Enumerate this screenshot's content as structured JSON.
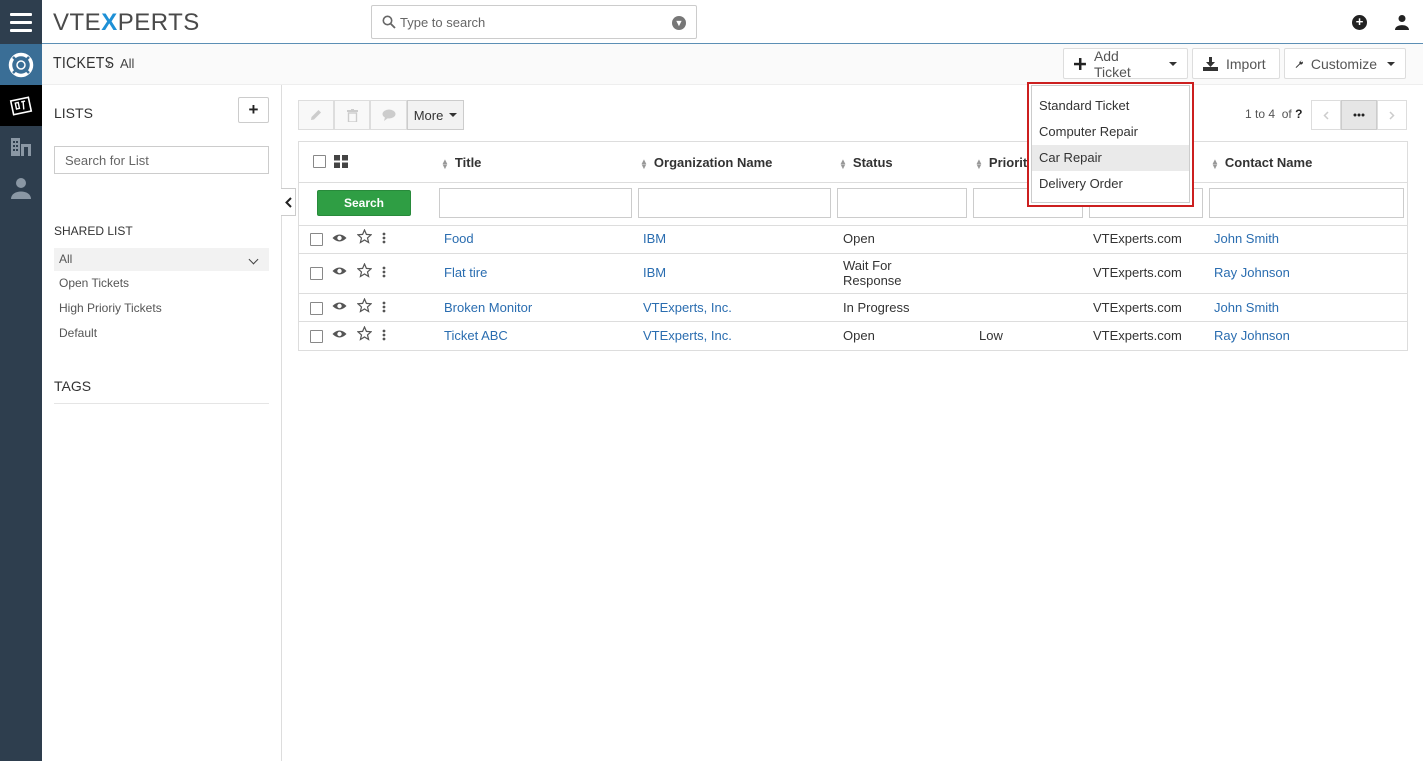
{
  "header": {
    "logo_left": "VTE",
    "logo_x": "X",
    "logo_right": "PERTS",
    "search_placeholder": "Type to search"
  },
  "breadcrumb": {
    "module": "TICKETS",
    "separator": "›",
    "view": "All"
  },
  "actions": {
    "add_ticket": "Add Ticket",
    "import": "Import",
    "customize": "Customize"
  },
  "add_ticket_menu": [
    {
      "label": "Standard Ticket"
    },
    {
      "label": "Computer Repair"
    },
    {
      "label": "Car Repair"
    },
    {
      "label": "Delivery Order"
    }
  ],
  "sidebar": {
    "lists_title": "LISTS",
    "add_label": "+",
    "search_placeholder": "Search for List",
    "shared_title": "SHARED LIST",
    "items": [
      "All",
      "Open Tickets",
      "High Prioriy Tickets",
      "Default"
    ],
    "tags_title": "TAGS"
  },
  "toolbar": {
    "more": "More",
    "pager_range": "1 to 4",
    "pager_of": "of",
    "pager_total": "?"
  },
  "table": {
    "columns": [
      "Title",
      "Organization Name",
      "Status",
      "Priority",
      "",
      "Contact Name"
    ],
    "search_label": "Search",
    "rows": [
      {
        "title": "Food",
        "org": "IBM",
        "status_1": "Open",
        "status_2": "",
        "priority": "",
        "company": "VTExperts.com",
        "contact": "John Smith"
      },
      {
        "title": "Flat tire",
        "org": "IBM",
        "status_1": "Wait For",
        "status_2": "Response",
        "priority": "",
        "company": "VTExperts.com",
        "contact": "Ray Johnson"
      },
      {
        "title": "Broken Monitor",
        "org": "VTExperts, Inc.",
        "status_1": "In Progress",
        "status_2": "",
        "priority": "",
        "company": "VTExperts.com",
        "contact": "John Smith"
      },
      {
        "title": "Ticket ABC",
        "org": "VTExperts, Inc.",
        "status_1": "Open",
        "status_2": "",
        "priority": "Low",
        "company": "VTExperts.com",
        "contact": "Ray Johnson"
      }
    ]
  },
  "colors": {
    "appbar": "#2e3e4e",
    "accent": "#2a6db0",
    "search_button": "#2f9e44",
    "highlight_border": "#cc1f1f"
  }
}
